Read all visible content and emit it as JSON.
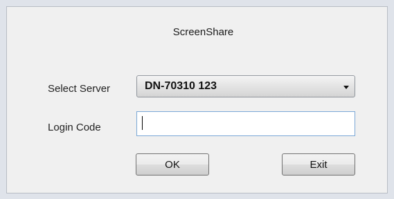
{
  "dialog": {
    "title": "ScreenShare",
    "server_label": "Select Server",
    "server_value": "DN-70310 123",
    "login_label": "Login Code",
    "login_value": "",
    "ok_label": "OK",
    "exit_label": "Exit"
  },
  "icons": {
    "dropdown": "chevron-down-icon"
  }
}
